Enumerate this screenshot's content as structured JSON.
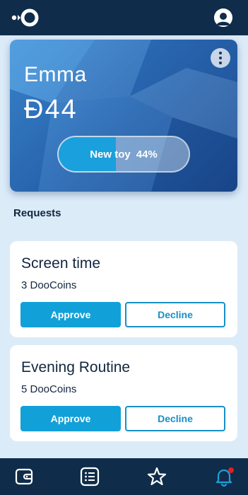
{
  "app": {
    "logo_icon": "doocoins-logo-icon",
    "profile_icon": "user-avatar-icon"
  },
  "kid": {
    "name": "Emma",
    "currency_symbol": "Đ",
    "balance": "44",
    "goal": {
      "label": "New toy",
      "percent_label": "44%",
      "progress": 0.44
    }
  },
  "requests": {
    "title": "Requests",
    "items": [
      {
        "title": "Screen time",
        "amount": "3 DooCoins",
        "approve_label": "Approve",
        "decline_label": "Decline"
      },
      {
        "title": "Evening Routine",
        "amount": "5 DooCoins",
        "approve_label": "Approve",
        "decline_label": "Decline"
      }
    ]
  },
  "nav": {
    "items": [
      {
        "icon": "wallet-icon",
        "active": false
      },
      {
        "icon": "list-icon",
        "active": false
      },
      {
        "icon": "star-icon",
        "active": false
      },
      {
        "icon": "bell-icon",
        "active": true,
        "has_notification": true
      }
    ]
  },
  "colors": {
    "bar": "#0f2c4a",
    "accent": "#12a0d8",
    "background": "#dcebf8",
    "notification": "#e02020"
  }
}
